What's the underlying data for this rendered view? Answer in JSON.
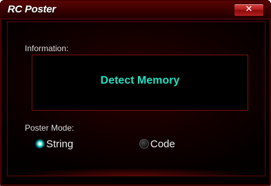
{
  "window": {
    "title": "RC Poster",
    "close_label": "✕"
  },
  "information": {
    "label": "Information:",
    "text": "Detect Memory"
  },
  "poster_mode": {
    "label": "Poster Mode:",
    "options": [
      {
        "label": "String",
        "selected": true
      },
      {
        "label": "Code",
        "selected": false
      }
    ]
  },
  "colors": {
    "accent_text": "#20e0c0",
    "window_bg": "#1a0000",
    "close_button": "#b01818"
  },
  "icons": {
    "close": "close-icon",
    "radio_selected": "radio-selected-icon",
    "radio_unselected": "radio-unselected-icon"
  }
}
